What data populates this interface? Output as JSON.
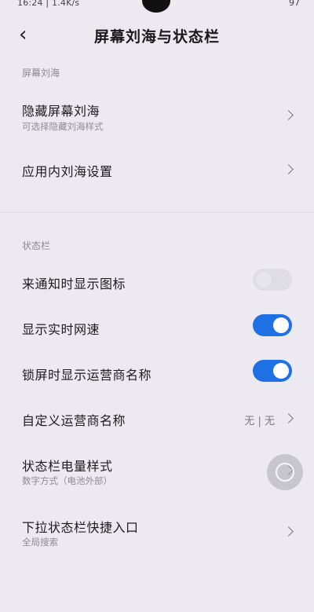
{
  "status_bar": {
    "time": "16:24",
    "speed": "1.4K/s",
    "right_text": "97"
  },
  "header": {
    "title": "屏幕刘海与状态栏"
  },
  "sections": {
    "notch": {
      "label": "屏幕刘海"
    },
    "statusbar": {
      "label": "状态栏"
    }
  },
  "rows": {
    "hide_notch": {
      "title": "隐藏屏幕刘海",
      "subtitle": "可选择隐藏刘海样式"
    },
    "in_app_notch": {
      "title": "应用内刘海设置"
    },
    "show_icons_on_notification": {
      "title": "来通知时显示图标",
      "enabled": false
    },
    "realtime_speed": {
      "title": "显示实时网速",
      "enabled": true
    },
    "carrier_on_lockscreen": {
      "title": "锁屏时显示运营商名称",
      "enabled": true
    },
    "custom_carrier": {
      "title": "自定义运营商名称",
      "value": "无 | 无"
    },
    "battery_style": {
      "title": "状态栏电量样式",
      "subtitle": "数字方式（电池外部）"
    },
    "pulldown_shortcut": {
      "title": "下拉状态栏快捷入口",
      "subtitle": "全局搜索"
    }
  },
  "colors": {
    "toggle_on": "#1f6fe5",
    "background": "#ece9f0"
  }
}
